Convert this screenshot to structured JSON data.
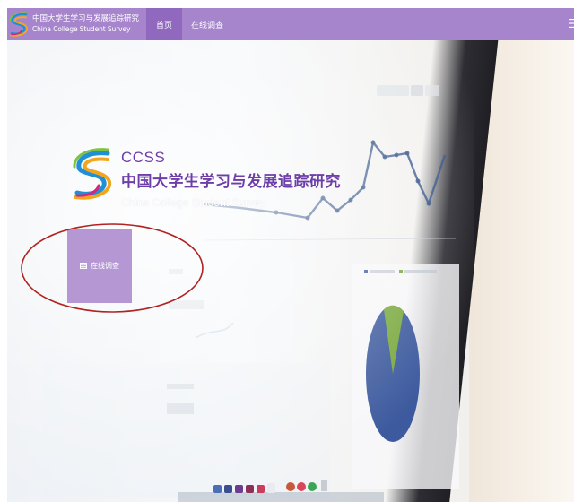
{
  "nav": {
    "brand_cn": "中国大学生学习与发展追踪研究",
    "brand_en": "China College Student Survey",
    "items": [
      {
        "label": "首页",
        "active": true
      },
      {
        "label": "在线调查",
        "active": false
      }
    ]
  },
  "hero": {
    "abbr": "CCSS",
    "title_cn": "中国大学生学习与发展追踪研究",
    "title_en": "China College Student Survey",
    "survey_button": "在线调查"
  },
  "colors": {
    "nav_bg": "#a685cc",
    "nav_active": "#9069be",
    "brand_purple": "#6d3ea8",
    "tile_bg": "#b597d4",
    "annotation": "#b22222"
  }
}
